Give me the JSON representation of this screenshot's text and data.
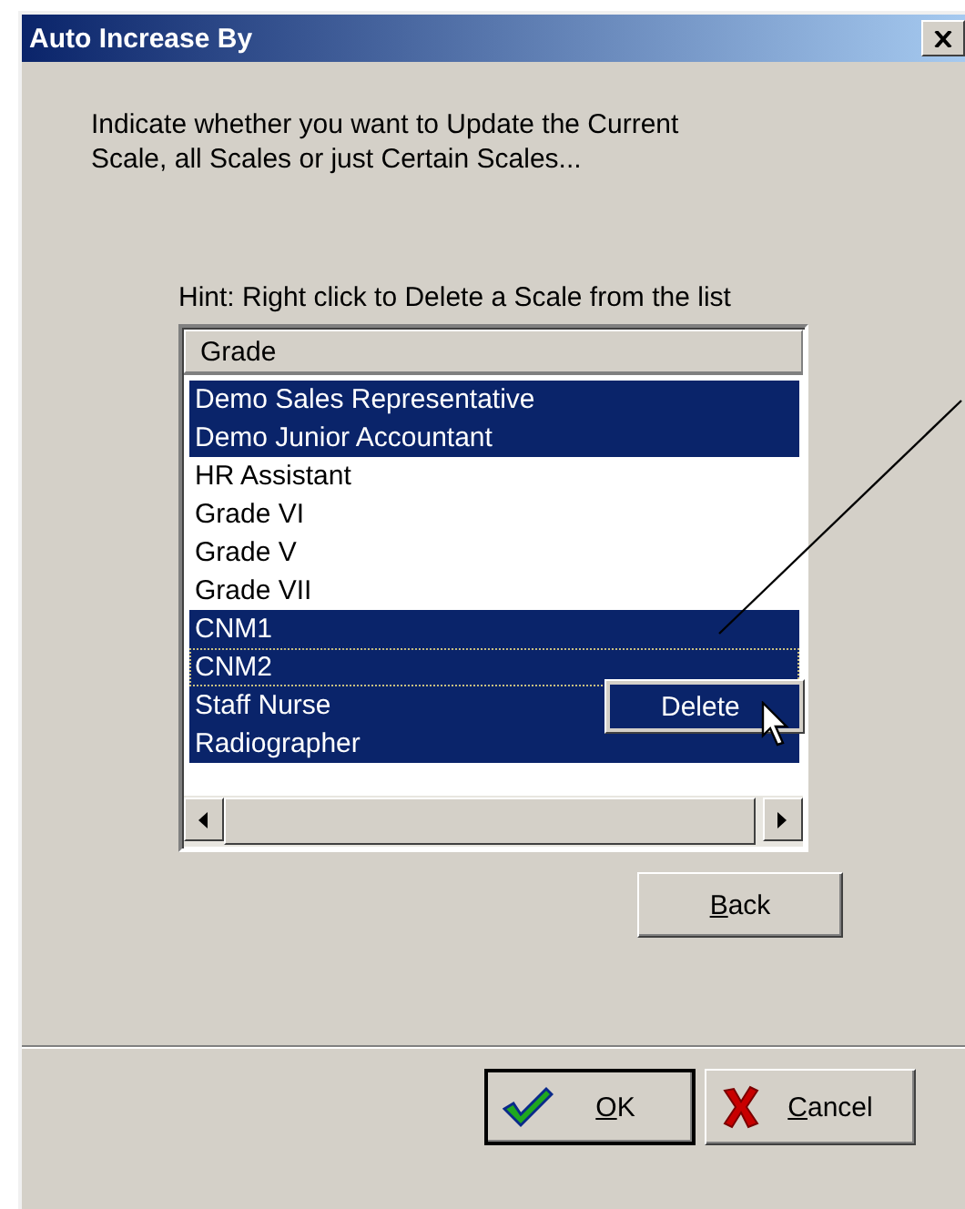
{
  "window": {
    "title": "Auto Increase By"
  },
  "message": "Indicate whether you want to Update the Current Scale, all Scales or just Certain Scales...",
  "hint": "Hint: Right click to Delete a Scale from the list",
  "list": {
    "columns": [
      "Grade"
    ],
    "rows": [
      {
        "label": "Demo Sales Representative",
        "selected": true,
        "focused": false
      },
      {
        "label": "Demo Junior Accountant",
        "selected": true,
        "focused": false
      },
      {
        "label": "HR Assistant",
        "selected": false,
        "focused": false
      },
      {
        "label": "Grade VI",
        "selected": false,
        "focused": false
      },
      {
        "label": "Grade V",
        "selected": false,
        "focused": false
      },
      {
        "label": "Grade VII",
        "selected": false,
        "focused": false
      },
      {
        "label": "CNM1",
        "selected": true,
        "focused": false
      },
      {
        "label": "CNM2",
        "selected": true,
        "focused": true
      },
      {
        "label": "Staff Nurse",
        "selected": true,
        "focused": false
      },
      {
        "label": "Radiographer",
        "selected": true,
        "focused": false
      }
    ]
  },
  "context_menu": {
    "items": [
      {
        "label": "Delete",
        "selected": true
      }
    ]
  },
  "buttons": [
    {
      "kind": "back",
      "mnemonic": "B",
      "rest": "ack",
      "default": false
    },
    {
      "kind": "ok",
      "mnemonic": "O",
      "rest": "K",
      "default": true
    },
    {
      "kind": "cancel",
      "mnemonic": "C",
      "rest": "ancel",
      "default": false
    }
  ]
}
